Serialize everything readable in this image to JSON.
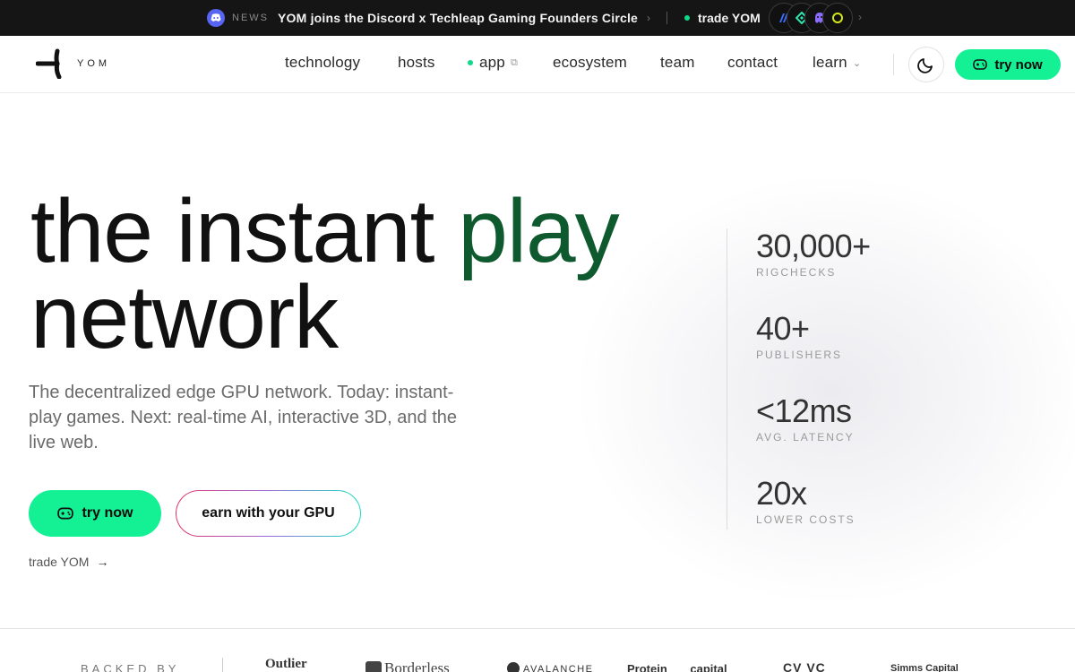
{
  "topbar": {
    "news_label": "NEWS",
    "news_text": "YOM joins the Discord x Techleap Gaming Founders Circle",
    "trade_label": "trade YOM",
    "exchange_icons": [
      "exchange-blue-icon",
      "exchange-teal-icon",
      "exchange-purple-icon",
      "exchange-yellow-icon"
    ]
  },
  "header": {
    "logo_text": "YOM",
    "nav": [
      "technology",
      "hosts",
      "app",
      "ecosystem",
      "team",
      "contact",
      "learn"
    ],
    "try_label": "try now"
  },
  "hero": {
    "title_part1": "the instant ",
    "title_highlight": "play",
    "title_line2": "network",
    "subtitle": "The decentralized edge GPU network. Today: instant-play games. Next: real-time AI, interactive 3D, and the live web.",
    "try_label": "try now",
    "earn_label": "earn with your GPU",
    "trade_label": "trade YOM"
  },
  "stats": [
    {
      "value": "30,000+",
      "label": "RIGCHECKS"
    },
    {
      "value": "40+",
      "label": "PUBLISHERS"
    },
    {
      "value": "<12ms",
      "label": "AVG. LATENCY"
    },
    {
      "value": "20x",
      "label": "LOWER COSTS"
    }
  ],
  "backed_by": {
    "label": "BACKED BY",
    "backers": [
      "Outlier Ventures",
      "Borderless",
      "AVALANCHE",
      "Protein capital",
      "CV VC",
      "Simms Capital"
    ]
  },
  "colors": {
    "accent": "#14f195",
    "play_green": "#0e5a2e",
    "topbar_bg": "#151515"
  }
}
